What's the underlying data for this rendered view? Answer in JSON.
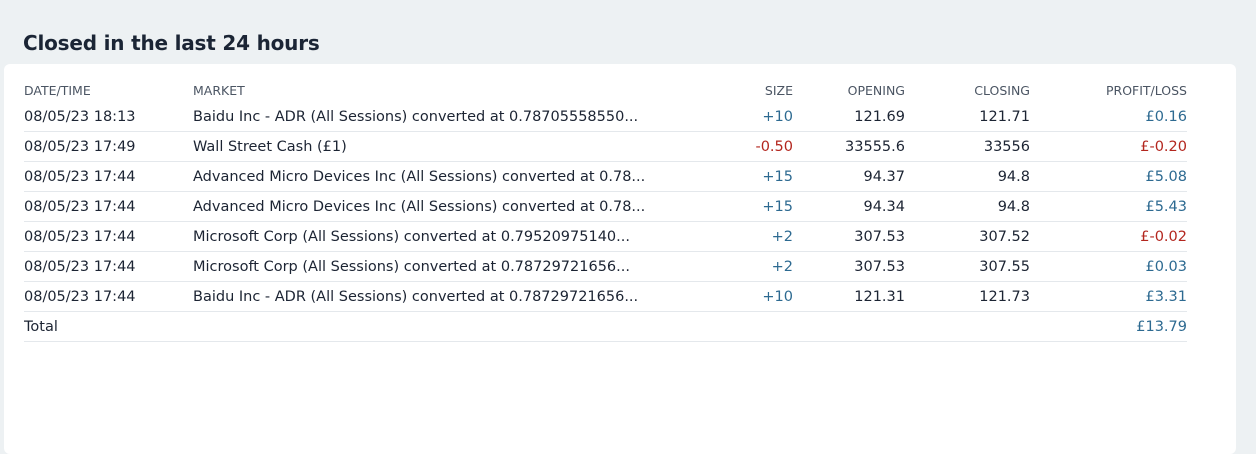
{
  "page": {
    "title": "Closed in the last 24 hours"
  },
  "table": {
    "headers": {
      "datetime": "DATE/TIME",
      "market": "MARKET",
      "size": "SIZE",
      "opening": "OPENING",
      "closing": "CLOSING",
      "profit_loss": "PROFIT/LOSS"
    },
    "rows": [
      {
        "datetime": "08/05/23 18:13",
        "market": "Baidu Inc - ADR (All Sessions) converted at 0.78705558550...",
        "size": "+10",
        "opening": "121.69",
        "closing": "121.71",
        "profit_loss": "£0.16"
      },
      {
        "datetime": "08/05/23 17:49",
        "market": "Wall Street Cash (£1)",
        "size": "-0.50",
        "opening": "33555.6",
        "closing": "33556",
        "profit_loss": "£-0.20"
      },
      {
        "datetime": "08/05/23 17:44",
        "market": "Advanced Micro Devices Inc (All Sessions) converted at 0.78...",
        "size": "+15",
        "opening": "94.37",
        "closing": "94.8",
        "profit_loss": "£5.08"
      },
      {
        "datetime": "08/05/23 17:44",
        "market": "Advanced Micro Devices Inc (All Sessions) converted at 0.78...",
        "size": "+15",
        "opening": "94.34",
        "closing": "94.8",
        "profit_loss": "£5.43"
      },
      {
        "datetime": "08/05/23 17:44",
        "market": "Microsoft Corp (All Sessions) converted at 0.79520975140...",
        "size": "+2",
        "opening": "307.53",
        "closing": "307.52",
        "profit_loss": "£-0.02"
      },
      {
        "datetime": "08/05/23 17:44",
        "market": "Microsoft Corp (All Sessions) converted at 0.78729721656...",
        "size": "+2",
        "opening": "307.53",
        "closing": "307.55",
        "profit_loss": "£0.03"
      },
      {
        "datetime": "08/05/23 17:44",
        "market": "Baidu Inc - ADR (All Sessions) converted at 0.78729721656...",
        "size": "+10",
        "opening": "121.31",
        "closing": "121.73",
        "profit_loss": "£3.31"
      }
    ],
    "total": {
      "label": "Total",
      "profit_loss": "£13.79"
    }
  },
  "colors": {
    "positive": "#2d6a91",
    "negative": "#b3261e",
    "background": "#edf1f3",
    "card": "#ffffff"
  }
}
